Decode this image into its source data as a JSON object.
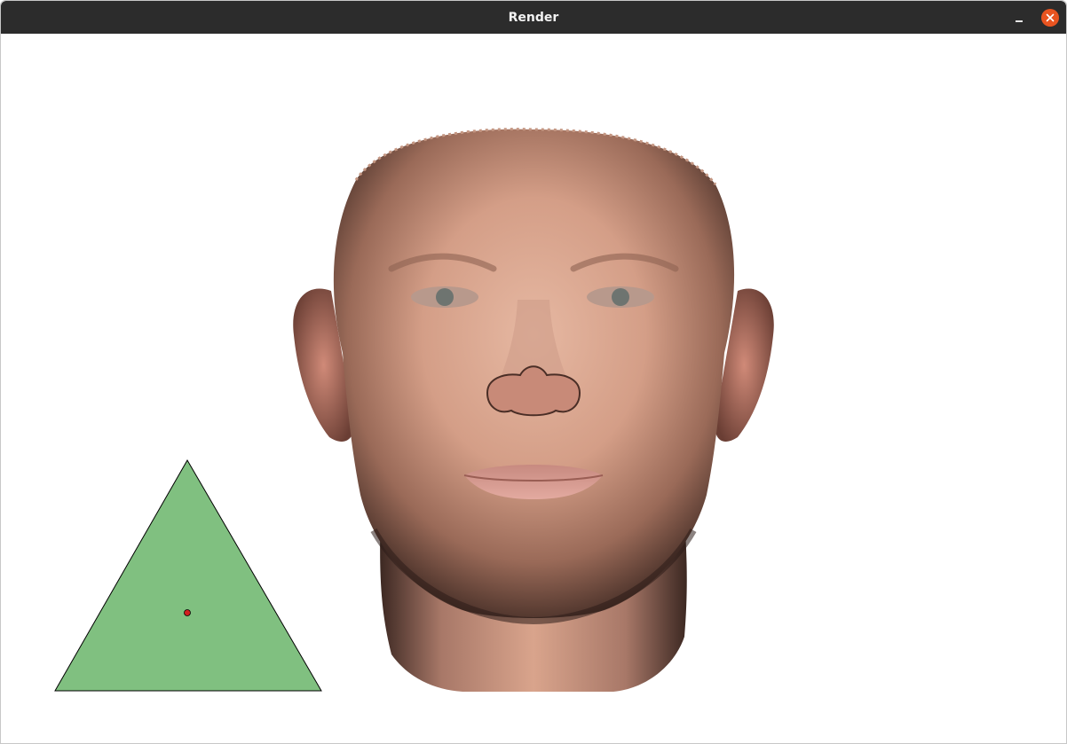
{
  "window": {
    "title": "Render",
    "controls": {
      "minimize_icon": "minimize-icon",
      "close_icon": "close-icon"
    }
  },
  "viewport": {
    "background": "#ffffff",
    "objects": {
      "head_model": {
        "kind": "3d-face-mesh",
        "skin_tone": "#d9a48c"
      },
      "triangle": {
        "fill": "#80c080",
        "stroke": "#000000",
        "marker_color": "#d02020"
      }
    }
  },
  "colors": {
    "titlebar": "#2c2c2c",
    "close": "#e95420"
  }
}
